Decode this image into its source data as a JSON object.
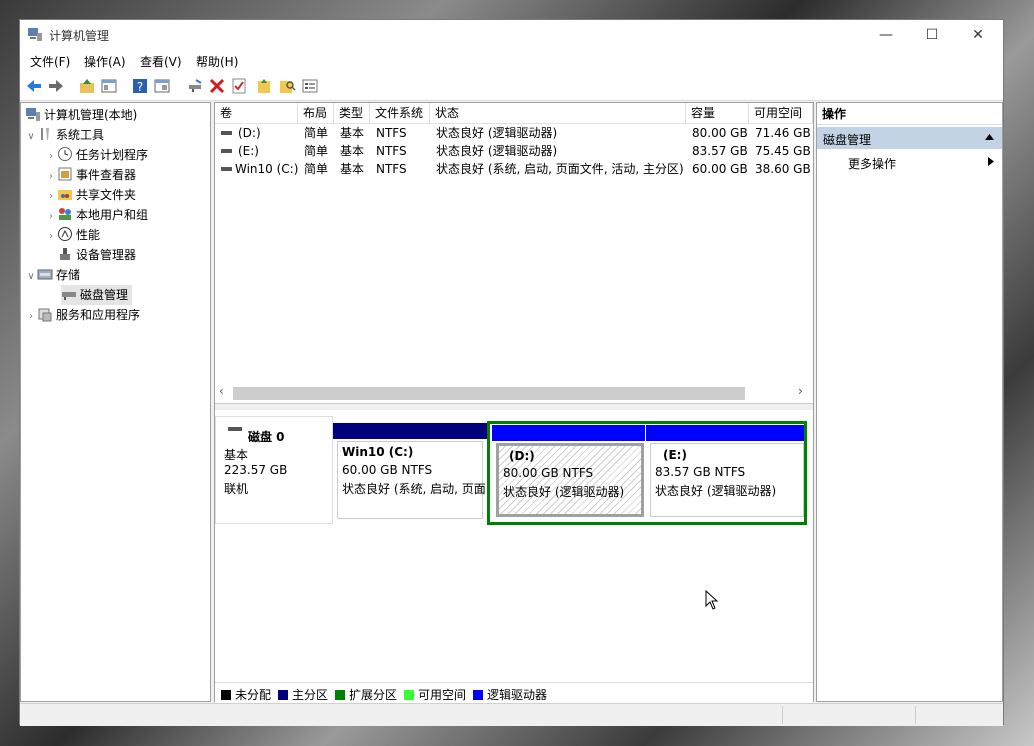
{
  "window": {
    "title": "计算机管理"
  },
  "window_controls": {
    "minimize": "—",
    "maximize": "☐",
    "close": "✕"
  },
  "menu": [
    "文件(F)",
    "操作(A)",
    "查看(V)",
    "帮助(H)"
  ],
  "tree": {
    "root": "计算机管理(本地)",
    "system_tools": "系统工具",
    "task_scheduler": "任务计划程序",
    "event_viewer": "事件查看器",
    "shared_folders": "共享文件夹",
    "local_users": "本地用户和组",
    "performance": "性能",
    "device_manager": "设备管理器",
    "storage": "存储",
    "disk_management": "磁盘管理",
    "services_apps": "服务和应用程序"
  },
  "volumes": {
    "columns": [
      "卷",
      "布局",
      "类型",
      "文件系统",
      "状态",
      "容量",
      "可用空间"
    ],
    "rows": [
      {
        "name": "(D:)",
        "layout": "简单",
        "type": "基本",
        "fs": "NTFS",
        "status": "状态良好 (逻辑驱动器)",
        "capacity": "80.00 GB",
        "free": "71.46 GB"
      },
      {
        "name": "(E:)",
        "layout": "简单",
        "type": "基本",
        "fs": "NTFS",
        "status": "状态良好 (逻辑驱动器)",
        "capacity": "83.57 GB",
        "free": "75.45 GB"
      },
      {
        "name": "Win10 (C:)",
        "layout": "简单",
        "type": "基本",
        "fs": "NTFS",
        "status": "状态良好 (系统, 启动, 页面文件, 活动, 主分区)",
        "capacity": "60.00 GB",
        "free": "38.60 GB"
      }
    ]
  },
  "disk0": {
    "name": "磁盘 0",
    "type": "基本",
    "size": "223.57 GB",
    "state": "联机",
    "partitions": [
      {
        "name": "Win10  (C:)",
        "size": "60.00 GB NTFS",
        "status": "状态良好 (系统, 启动, 页面"
      },
      {
        "name": "(D:)",
        "size": "80.00 GB NTFS",
        "status": "状态良好 (逻辑驱动器)"
      },
      {
        "name": "(E:)",
        "size": "83.57 GB NTFS",
        "status": "状态良好 (逻辑驱动器)"
      }
    ]
  },
  "legend": [
    "未分配",
    "主分区",
    "扩展分区",
    "可用空间",
    "逻辑驱动器"
  ],
  "colors": {
    "unallocated": "#000000",
    "primary": "#00007f",
    "extended": "#008000",
    "free": "#33ff33",
    "logical": "#0000ff",
    "actions_header": "#c3d3e6"
  },
  "actions": {
    "title": "操作",
    "section": "磁盘管理",
    "more": "更多操作"
  },
  "icons": [
    "back-arrow-icon",
    "forward-arrow-icon",
    "folder-up-icon",
    "show-hide-tree-icon",
    "help-icon",
    "properties-icon",
    "connect-drive-icon",
    "delete-icon",
    "check-icon",
    "yellow-folder-icon",
    "search-folder-icon",
    "list-icon"
  ]
}
